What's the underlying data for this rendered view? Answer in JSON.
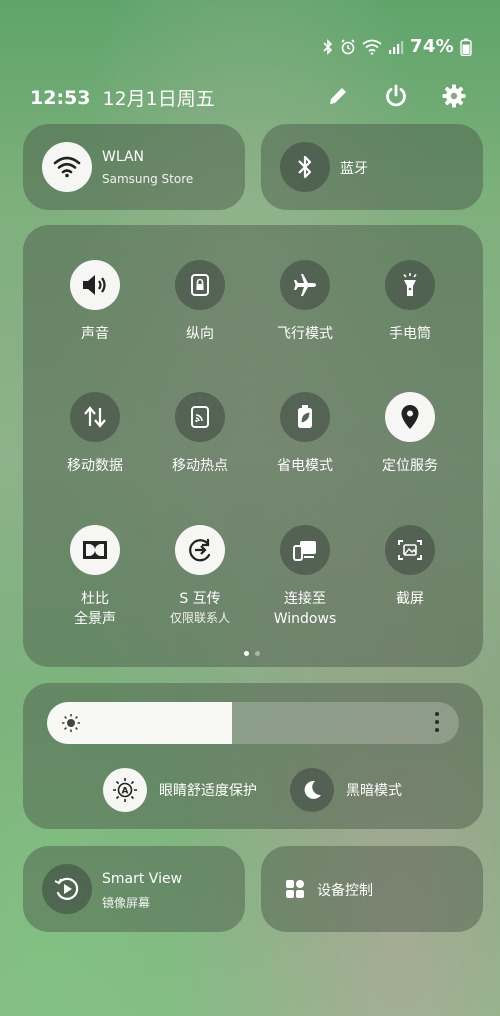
{
  "status_bar": {
    "battery": "74%"
  },
  "header": {
    "time": "12:53",
    "date": "12月1日周五"
  },
  "wlan": {
    "title": "WLAN",
    "subtitle": "Samsung Store"
  },
  "bluetooth": {
    "title": "蓝牙"
  },
  "quick_settings": [
    {
      "label": "声音"
    },
    {
      "label": "纵向"
    },
    {
      "label": "飞行模式"
    },
    {
      "label": "手电筒"
    },
    {
      "label": "移动数据"
    },
    {
      "label": "移动热点"
    },
    {
      "label": "省电模式"
    },
    {
      "label": "定位服务"
    },
    {
      "label": "杜比",
      "label2": "全景声"
    },
    {
      "label": "S 互传",
      "sub": "仅限联系人"
    },
    {
      "label": "连接至",
      "label2": "Windows"
    },
    {
      "label": "截屏"
    }
  ],
  "pagination": {
    "current": 1,
    "total": 2
  },
  "brightness": {
    "level": 0.45
  },
  "modes": {
    "eye_comfort": "眼睛舒适度保护",
    "dark_mode": "黑暗模式"
  },
  "smart_view": {
    "title": "Smart View",
    "subtitle": "镜像屏幕"
  },
  "device_control": {
    "title": "设备控制"
  }
}
